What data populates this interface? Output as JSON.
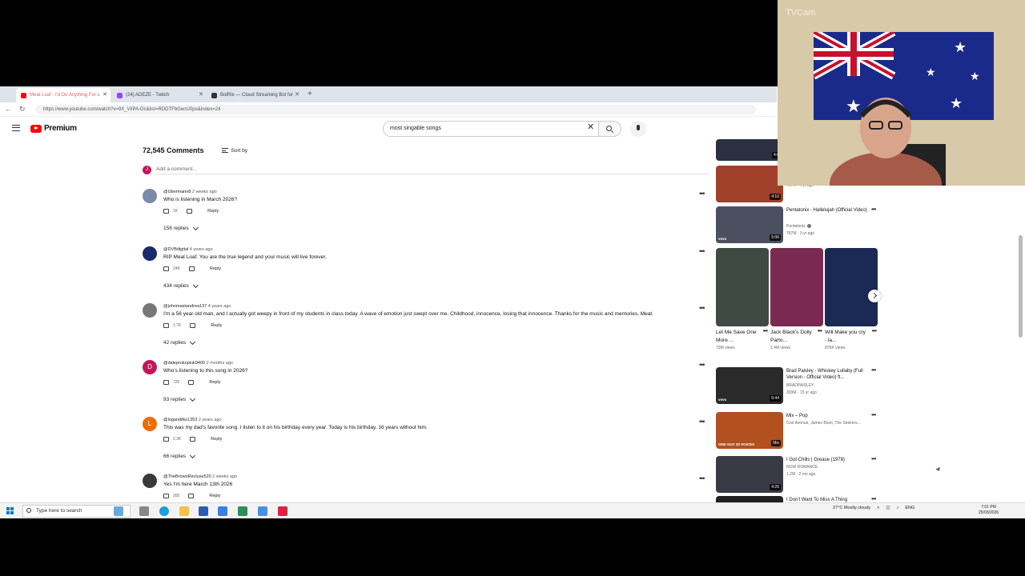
{
  "browser": {
    "tabs": [
      {
        "label": "Meat Loaf - I'd Do Anything For L",
        "active": true,
        "icon": "youtube-icon"
      },
      {
        "label": "(24) ADEZE - Twitch",
        "active": false,
        "icon": "twitch-icon"
      },
      {
        "label": "BotRix — Cloud Streaming Bot for",
        "active": false,
        "icon": "botrix-icon"
      }
    ],
    "new_tab": "+",
    "url": "https://www.youtube.com/watch?v=9X_ViIPA-Gc&list=RDDTFbGenU0po&index=24"
  },
  "youtube": {
    "logo_text": "Premium",
    "search_query": "most singable songs",
    "comments_count": "72,545 Comments",
    "sort_label": "Sort by",
    "add_comment_placeholder": "Add a comment...",
    "user_initial": "J",
    "comments": [
      {
        "handle": "@Ubermann8",
        "time": "2 weeks ago",
        "text": "Who is listening in March 2026?",
        "likes": "1K",
        "reply": "Reply",
        "replies": "158 replies",
        "avatar_initial": "",
        "avatar_color": "#7a8aa8"
      },
      {
        "handle": "@DVBdigital",
        "time": "4 years ago",
        "text": "RIP Meat Loaf. You are the true legend and your music will live forever.",
        "likes": "24K",
        "reply": "Reply",
        "replies": "434 replies",
        "avatar_initial": "",
        "avatar_color": "#1a2a6a"
      },
      {
        "handle": "@johnmastandrea137",
        "time": "4 years ago",
        "text": "I'm a 56 year old man, and I actually got weepy in front of my students in class today. A wave of emotion just swept over me. Childhood, innocence, losing that innocence.  Thanks for the music and memories, Meat.",
        "likes": "1.7K",
        "reply": "Reply",
        "replies": "42 replies",
        "avatar_initial": "",
        "avatar_color": "#777777"
      },
      {
        "handle": "@daleprokopiuk9400",
        "time": "2 months ago",
        "text": "Who's listening to this song in 2026?",
        "likes": "720",
        "reply": "Reply",
        "replies": "93 replies",
        "avatar_initial": "D",
        "avatar_color": "#c2185b"
      },
      {
        "handle": "@logandilks1353",
        "time": "2 years ago",
        "text": "This was my dad's favorite song. I listen to it on his birthday every year. Today is his birthday. 16 years without him.",
        "likes": "2.3K",
        "reply": "Reply",
        "replies": "66 replies",
        "avatar_initial": "L",
        "avatar_color": "#ef6c00"
      },
      {
        "handle": "@TheBrownRecluse520",
        "time": "2 weeks ago",
        "text": "Yes I'm here March 13th 2026",
        "likes": "265",
        "reply": "Reply",
        "replies": "",
        "avatar_initial": "",
        "avatar_color": "#3a3a3a"
      }
    ],
    "rail": {
      "top_videos": [
        {
          "duration": "4:0",
          "color": "#2a3040"
        },
        {
          "duration": "4:10",
          "color": "#a0402a",
          "stats": "727K · 4 yr ago"
        },
        {
          "title": "Pentatonix - Hallelujah (Official Video)",
          "channel": "Pentatonix",
          "stats": "787M · 9 yr ago",
          "duration": "5:06",
          "color": "#4a5060",
          "badge": "vevo"
        }
      ],
      "shorts": [
        {
          "title": "Let Me Save One More ...",
          "views": "73M views",
          "color": "#3e4a42"
        },
        {
          "title": "Jack Black's Dolly Parto...",
          "views": "2.4M views",
          "color": "#7a2a50"
        },
        {
          "title": "Will Make you cry - la...",
          "views": "876K views",
          "color": "#1a2a55"
        }
      ],
      "videos": [
        {
          "title": "Brad Paisley - Whiskey Lullaby (Full Version - Official Video) ft...",
          "channel": "BRADPAISLEY",
          "stats": "303M · 15 yr ago",
          "duration": "6:44",
          "color": "#2a2a2a",
          "badge": "vevo"
        },
        {
          "title": "Mix – Pop",
          "channel": "51st Avenue, James Blunt, The Seekers...",
          "stats": "",
          "duration": "Mix",
          "color": "#b25020",
          "badge": "ONE GUY 20 VOICES"
        },
        {
          "title": "I Got Chills | Grease (1978)",
          "channel": "NOW ROMANCE",
          "stats": "1.2M · 2 mo ago",
          "duration": "4:26",
          "color": "#3a3a44"
        },
        {
          "title": "I Don't Want To Miss A Thing",
          "channel": "",
          "stats": "",
          "duration": "",
          "color": "#222222"
        }
      ]
    }
  },
  "webcam": {
    "label": "TVCam"
  },
  "taskbar": {
    "search_placeholder": "Type here to search",
    "weather": "27°C  Mostly cloudy",
    "language": "ENG",
    "time": "7:01 PM",
    "date": "25/03/2026"
  }
}
